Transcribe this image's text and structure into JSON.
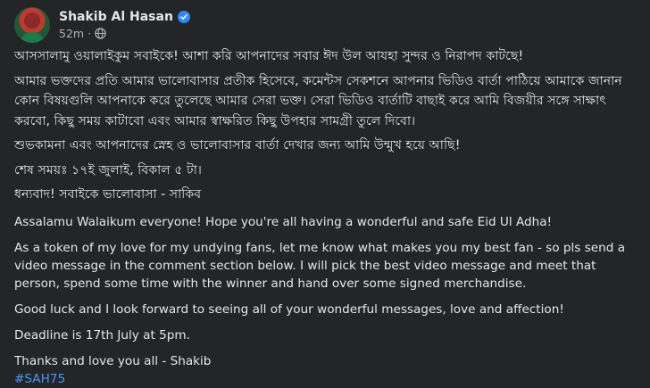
{
  "author": {
    "name": "Shakib Al Hasan",
    "time": "52m",
    "separator": "·"
  },
  "icons": {
    "verified": "verified-badge-icon",
    "audience": "globe-icon",
    "accent": "#4599ff"
  },
  "post": {
    "bn_1": "আসসালামু ওয়ালাইকুম সবাইকে! আশা করি আপনাদের সবার ঈদ উল আযহা সুন্দর ও নিরাপদ কাটছে!",
    "bn_2": "আমার ভক্তদের প্রতি আমার ভালোবাসার প্রতীক হিসেবে, কমেন্টস সেকশনে আপনার ভিডিও বার্তা পাঠিয়ে আমাকে জানান কোন বিষয়গুলি আপনাকে করে তুলেছে আমার সেরা ভক্ত। সেরা ভিডিও বার্তাটি বাছাই করে আমি বিজয়ীর সঙ্গে সাক্ষাৎ করবো, কিছু সময় কাটাবো এবং আমার স্বাক্ষরিত কিছু উপহার সামগ্রী তুলে দিবো।",
    "bn_3": "শুভকামনা এবং আপনাদের স্নেহ ও ভালোবাসার বার্তা দেখার জন্য আমি উন্মুখ হয়ে আছি!",
    "bn_4": "শেষ সময়ঃ ১৭ই জুলাই, বিকাল ৫ টা।",
    "bn_5": "ধন্যবাদ! সবাইকে ভালোবাসা - সাকিব",
    "en_1": "Assalamu Walaikum everyone! Hope you're all having a wonderful and safe Eid Ul Adha!",
    "en_2": "As a token of my love for my undying fans, let me know what makes you my best fan - so pls send a video message in the comment section below. I will pick the best video message and meet that person, spend some time with the winner and hand over some signed merchandise.",
    "en_3": "Good luck and I look forward to seeing all of your wonderful messages, love and affection!",
    "en_4": "Deadline is 17th July at 5pm.",
    "en_5": "Thanks and love you all - Shakib",
    "hashtag": "#SAH75"
  }
}
